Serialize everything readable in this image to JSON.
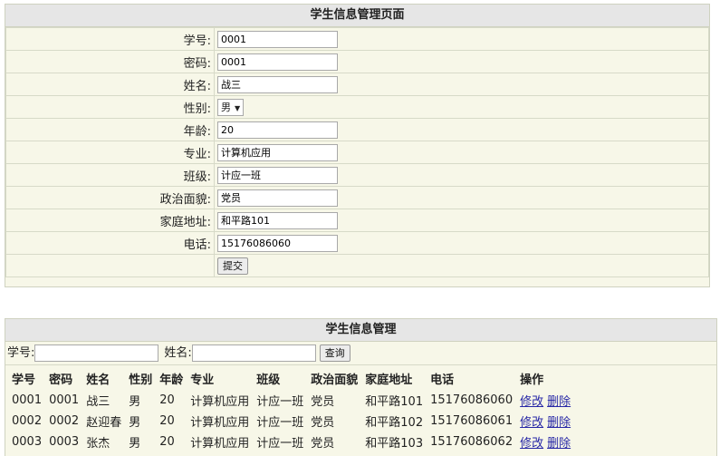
{
  "form": {
    "title": "学生信息管理页面",
    "fields": [
      {
        "label": "学号:",
        "value": "0001"
      },
      {
        "label": "密码:",
        "value": "0001"
      },
      {
        "label": "姓名:",
        "value": "战三"
      },
      {
        "label": "性别:",
        "value": "男",
        "type": "select"
      },
      {
        "label": "年龄:",
        "value": "20"
      },
      {
        "label": "专业:",
        "value": "计算机应用"
      },
      {
        "label": "班级:",
        "value": "计应一班"
      },
      {
        "label": "政治面貌:",
        "value": "党员"
      },
      {
        "label": "家庭地址:",
        "value": "和平路101"
      },
      {
        "label": "电话:",
        "value": "15176086060"
      }
    ],
    "submit_label": "提交"
  },
  "list": {
    "title": "学生信息管理",
    "search": {
      "id_label": "学号:",
      "id_value": "",
      "name_label": "姓名:",
      "name_value": "",
      "button_label": "查询"
    },
    "columns": [
      "学号",
      "密码",
      "姓名",
      "性别",
      "年龄",
      "专业",
      "班级",
      "政治面貌",
      "家庭地址",
      "电话",
      "操作"
    ],
    "rows": [
      [
        "0001",
        "0001",
        "战三",
        "男",
        "20",
        "计算机应用",
        "计应一班",
        "党员",
        "和平路101",
        "15176086060"
      ],
      [
        "0002",
        "0002",
        "赵迎春",
        "男",
        "20",
        "计算机应用",
        "计应一班",
        "党员",
        "和平路102",
        "15176086061"
      ],
      [
        "0003",
        "0003",
        "张杰",
        "男",
        "20",
        "计算机应用",
        "计应一班",
        "党员",
        "和平路103",
        "15176086062"
      ]
    ],
    "edit_label": "修改",
    "delete_label": "删除"
  },
  "colors": {
    "panel_bg": "#f7f7e8",
    "title_bg": "#e6e6e6",
    "link": "#2727a6"
  }
}
